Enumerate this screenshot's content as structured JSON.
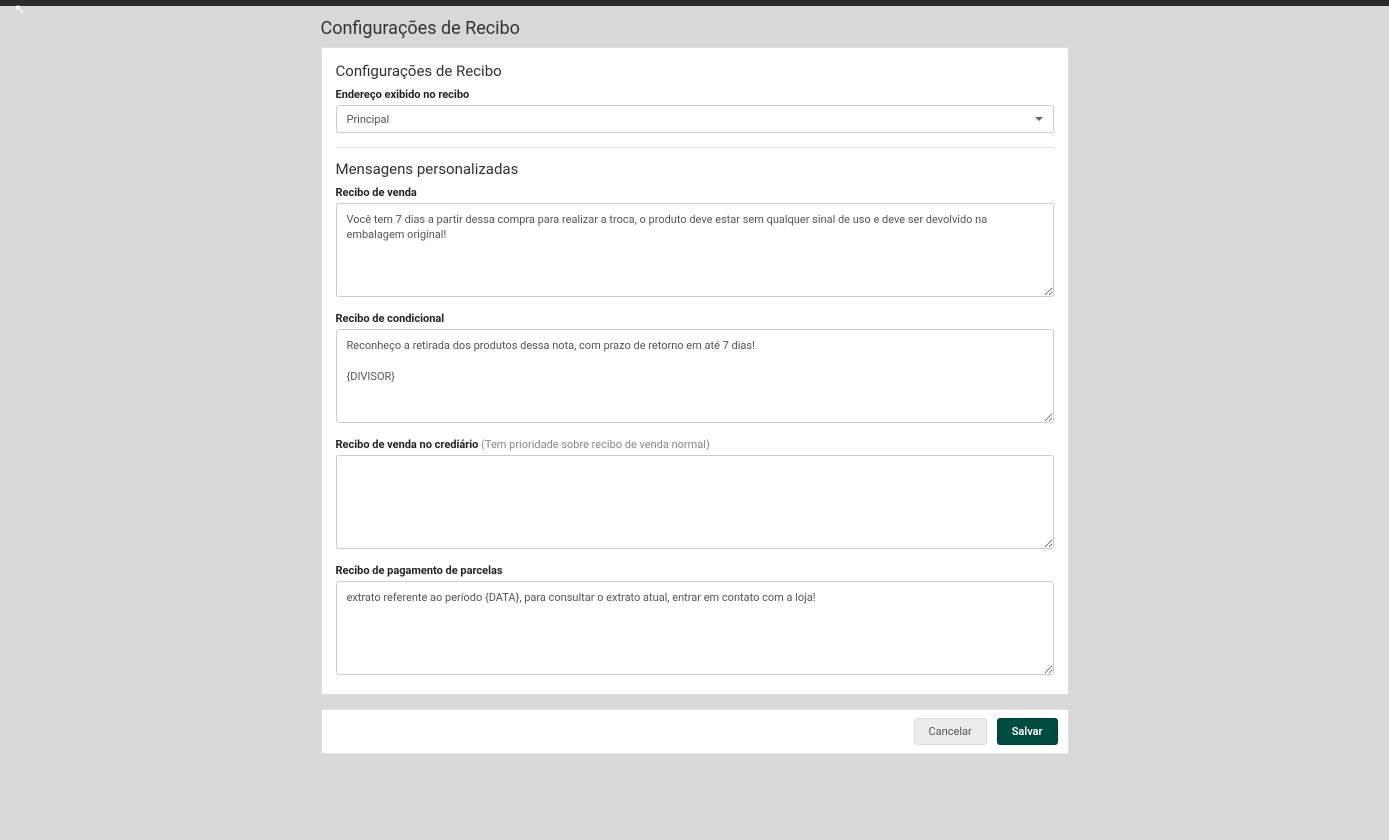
{
  "page": {
    "title": "Configurações de Recibo"
  },
  "section_receipt": {
    "title": "Configurações de Recibo",
    "address_label": "Endereço exibido no recibo",
    "address_selected": "Principal"
  },
  "section_messages": {
    "title": "Mensagens personalizadas",
    "sale": {
      "label": "Recibo de venda",
      "value": "Você tem 7 dias a partir dessa compra para realizar a troca, o produto deve estar sem qualquer sinal de uso e deve ser devolvido na embalagem original!"
    },
    "conditional": {
      "label": "Recibo de condicional",
      "value": "Reconheço a retirada dos produtos dessa nota, com prazo de retorno em até 7 dias!\n\n{DIVISOR}"
    },
    "credit_sale": {
      "label": "Recibo de venda no crediário",
      "hint": "(Tem prioridade sobre recibo de venda normal)",
      "value": ""
    },
    "installment": {
      "label": "Recibo de pagamento de parcelas",
      "value": "extrato referente ao período {DATA}, para consultar o extrato atual, entrar em contato com a loja!"
    }
  },
  "actions": {
    "cancel": "Cancelar",
    "save": "Salvar"
  }
}
